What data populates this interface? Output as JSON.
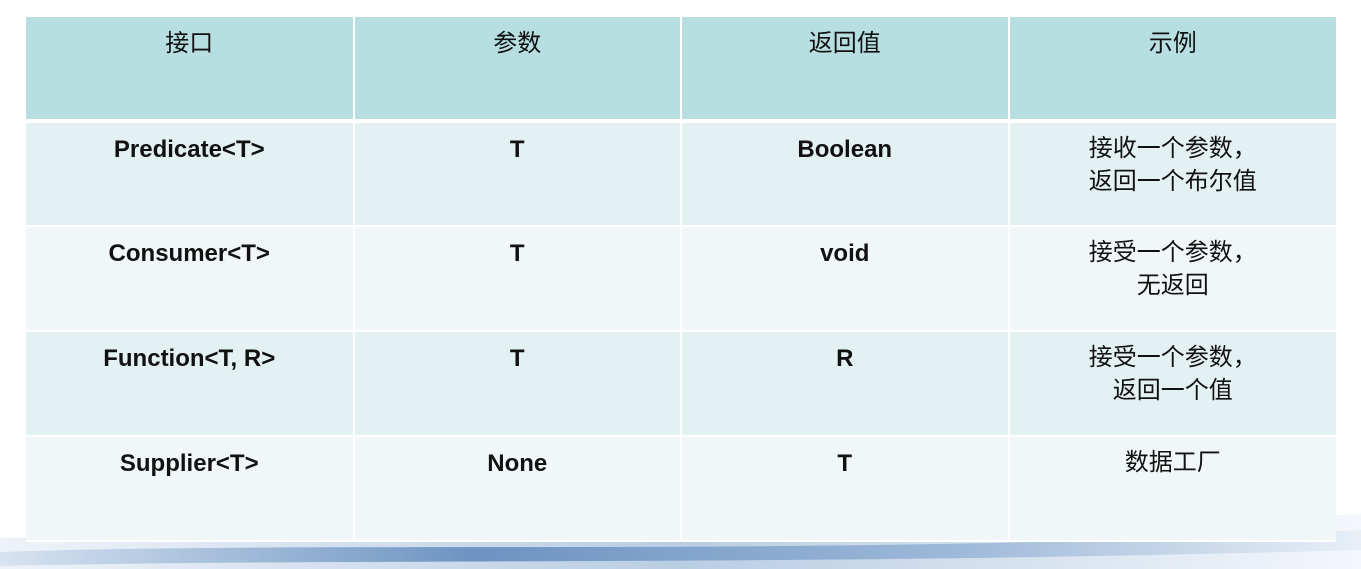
{
  "table": {
    "headers": [
      "接口",
      "参数",
      "返回值",
      "示例"
    ],
    "rows": [
      {
        "interface": "Predicate<T>",
        "param": "T",
        "return": "Boolean",
        "example": [
          "接收一个参数，",
          "返回一个布尔值"
        ]
      },
      {
        "interface": "Consumer<T>",
        "param": "T",
        "return": "void",
        "example": [
          "接受一个参数，",
          "无返回"
        ]
      },
      {
        "interface": "Function<T, R>",
        "param": "T",
        "return": "R",
        "example": [
          "接受一个参数，",
          "返回一个值"
        ]
      },
      {
        "interface": "Supplier<T>",
        "param": "None",
        "return": "T",
        "example": [
          "数据工厂"
        ]
      }
    ]
  },
  "colors": {
    "header_bg": "#b7dfe1",
    "row_bg_a": "#e4f1f2",
    "row_bg_b": "#f1f7f8",
    "swoosh": "#5f86b8"
  }
}
